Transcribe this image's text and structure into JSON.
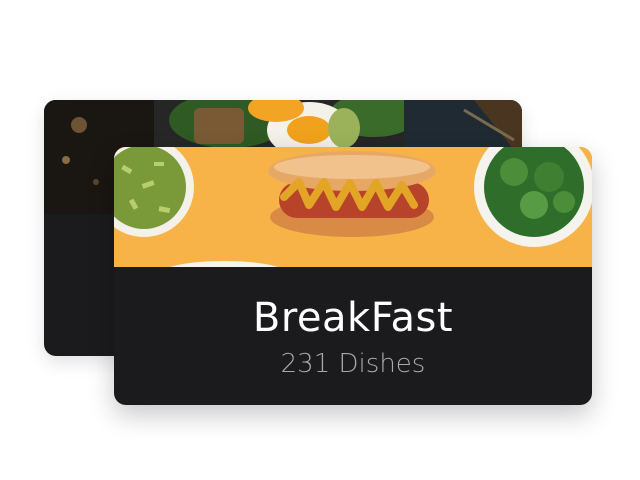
{
  "cards": [
    {
      "title": "",
      "subtitle": "",
      "image": "food-salad-egg-photo"
    },
    {
      "title": "BreakFast",
      "subtitle": "231 Dishes",
      "image": "hotdog-photo"
    }
  ],
  "colors": {
    "card_background": "#1b1b1e",
    "front_image_background": "#f7b347",
    "title_text": "#ffffff",
    "subtitle_text": "#a9a9ad"
  }
}
